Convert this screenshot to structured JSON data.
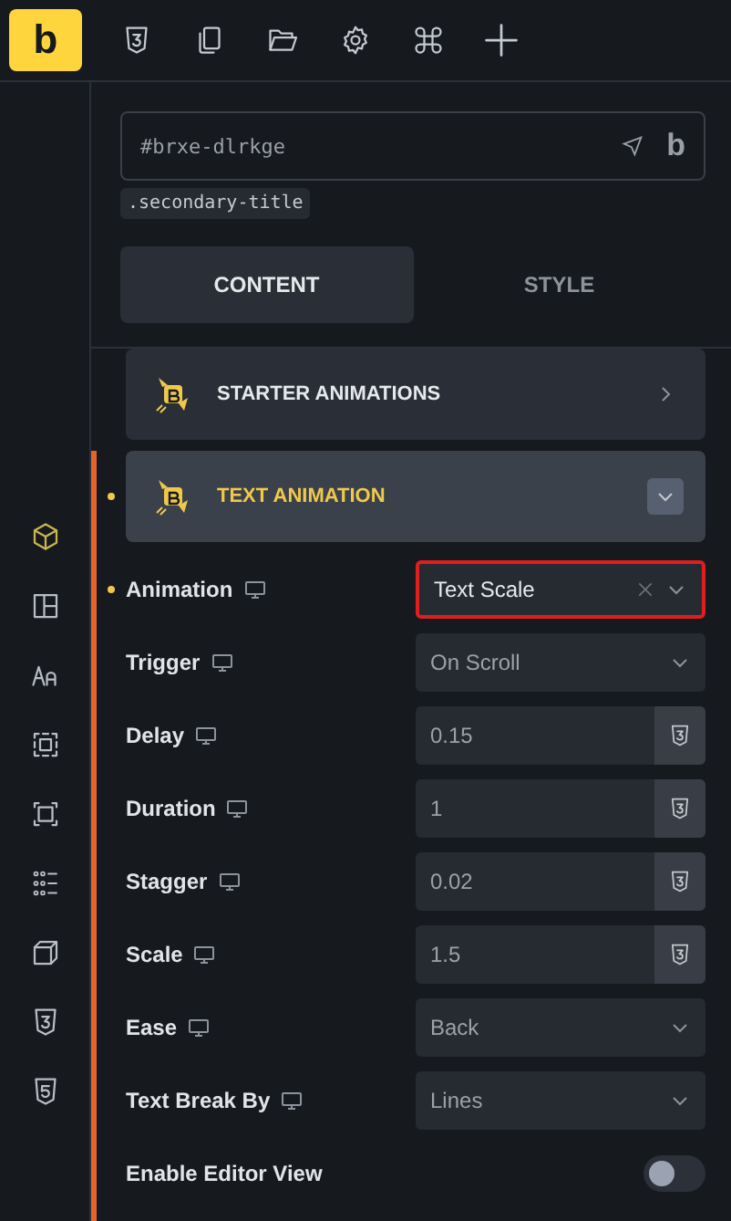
{
  "toolbar": {
    "logo": "b",
    "tools": [
      {
        "kind": "css"
      },
      {
        "kind": "pages"
      },
      {
        "kind": "folder"
      },
      {
        "kind": "settings"
      },
      {
        "kind": "command"
      },
      {
        "kind": "add"
      }
    ]
  },
  "rail": [
    {
      "kind": "cube",
      "selected": true
    },
    {
      "kind": "layout",
      "selected": false
    },
    {
      "kind": "typography",
      "selected": false
    },
    {
      "kind": "spacing",
      "selected": false
    },
    {
      "kind": "border",
      "selected": false
    },
    {
      "kind": "grid",
      "selected": false
    },
    {
      "kind": "transform",
      "selected": false
    },
    {
      "kind": "css",
      "selected": false
    },
    {
      "kind": "html",
      "selected": false
    }
  ],
  "element": {
    "id": "#brxe-dlrkge",
    "brand": "b",
    "class": ".secondary-title"
  },
  "tabs": [
    {
      "label": "CONTENT",
      "selected": true
    },
    {
      "label": "STYLE",
      "selected": false
    }
  ],
  "sections": [
    {
      "title": "STARTER ANIMATIONS",
      "expanded": false,
      "changed": false
    },
    {
      "title": "TEXT ANIMATION",
      "expanded": true,
      "changed": true
    }
  ],
  "fields": [
    {
      "kind": "select",
      "label": "Animation",
      "value": "Text Scale",
      "changed": true,
      "highlighted": true,
      "clearable": true
    },
    {
      "kind": "select",
      "label": "Trigger",
      "value": "On Scroll",
      "changed": false,
      "highlighted": false,
      "clearable": false
    },
    {
      "kind": "number",
      "label": "Delay",
      "value": "0.15",
      "changed": false,
      "highlighted": false
    },
    {
      "kind": "number",
      "label": "Duration",
      "value": "1",
      "changed": false,
      "highlighted": false
    },
    {
      "kind": "number",
      "label": "Stagger",
      "value": "0.02",
      "changed": false,
      "highlighted": false
    },
    {
      "kind": "number",
      "label": "Scale",
      "value": "1.5",
      "changed": false,
      "highlighted": false
    },
    {
      "kind": "select",
      "label": "Ease",
      "value": "Back",
      "changed": false,
      "highlighted": false,
      "clearable": false
    },
    {
      "kind": "select",
      "label": "Text Break By",
      "value": "Lines",
      "changed": false,
      "highlighted": false,
      "clearable": false
    },
    {
      "kind": "toggle",
      "label": "Enable Editor View",
      "on": false
    }
  ]
}
